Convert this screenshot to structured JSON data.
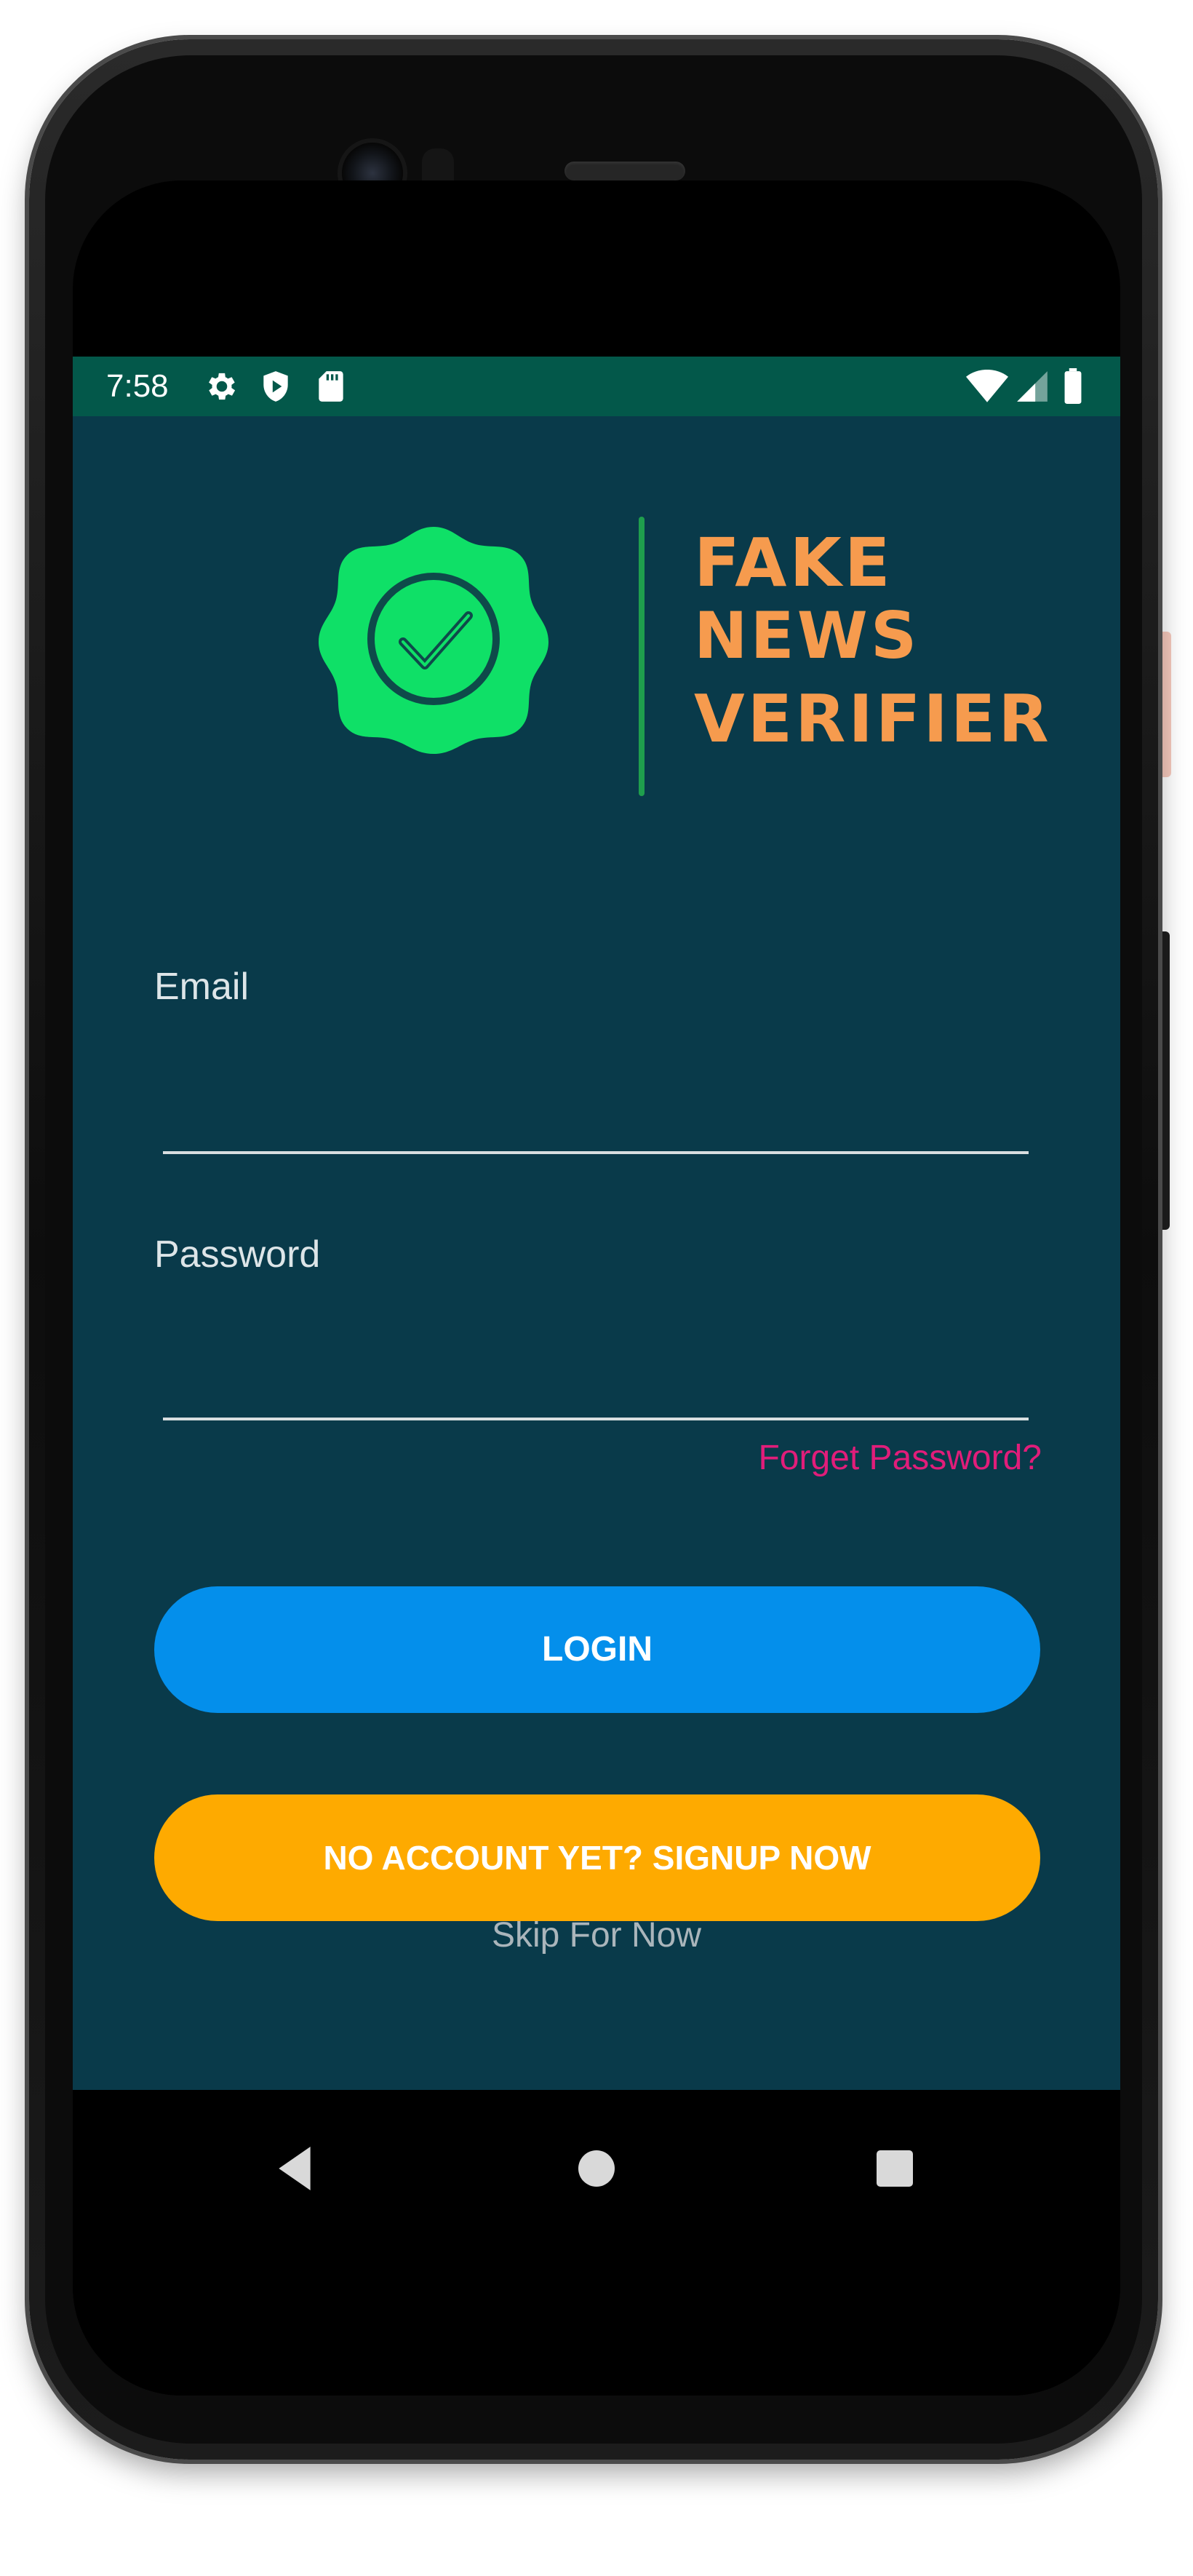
{
  "status_bar": {
    "time": "7:58",
    "icons": [
      "gear-icon",
      "shield-play-icon",
      "sd-card-icon"
    ],
    "right_icons": [
      "wifi-icon",
      "cell-signal-icon",
      "battery-icon"
    ]
  },
  "logo": {
    "line1": "FAKE",
    "line2": "NEWS",
    "line3": "VERIFIER",
    "badge_color": "#0fe067",
    "text_color": "#f69b4e"
  },
  "form": {
    "email_label": "Email",
    "email_value": "",
    "password_label": "Password",
    "password_value": "",
    "forget_password": "Forget Password?"
  },
  "buttons": {
    "login": "LOGIN",
    "signup": "NO ACCOUNT YET? SIGNUP NOW",
    "skip": "Skip For Now"
  },
  "nav": {
    "items": [
      "back-icon",
      "home-icon",
      "recents-icon"
    ]
  },
  "colors": {
    "background": "#093a4a",
    "status_bar": "#03584a",
    "login_button": "#048feb",
    "signup_button": "#feaa00",
    "forget_link": "#e11d7a"
  }
}
